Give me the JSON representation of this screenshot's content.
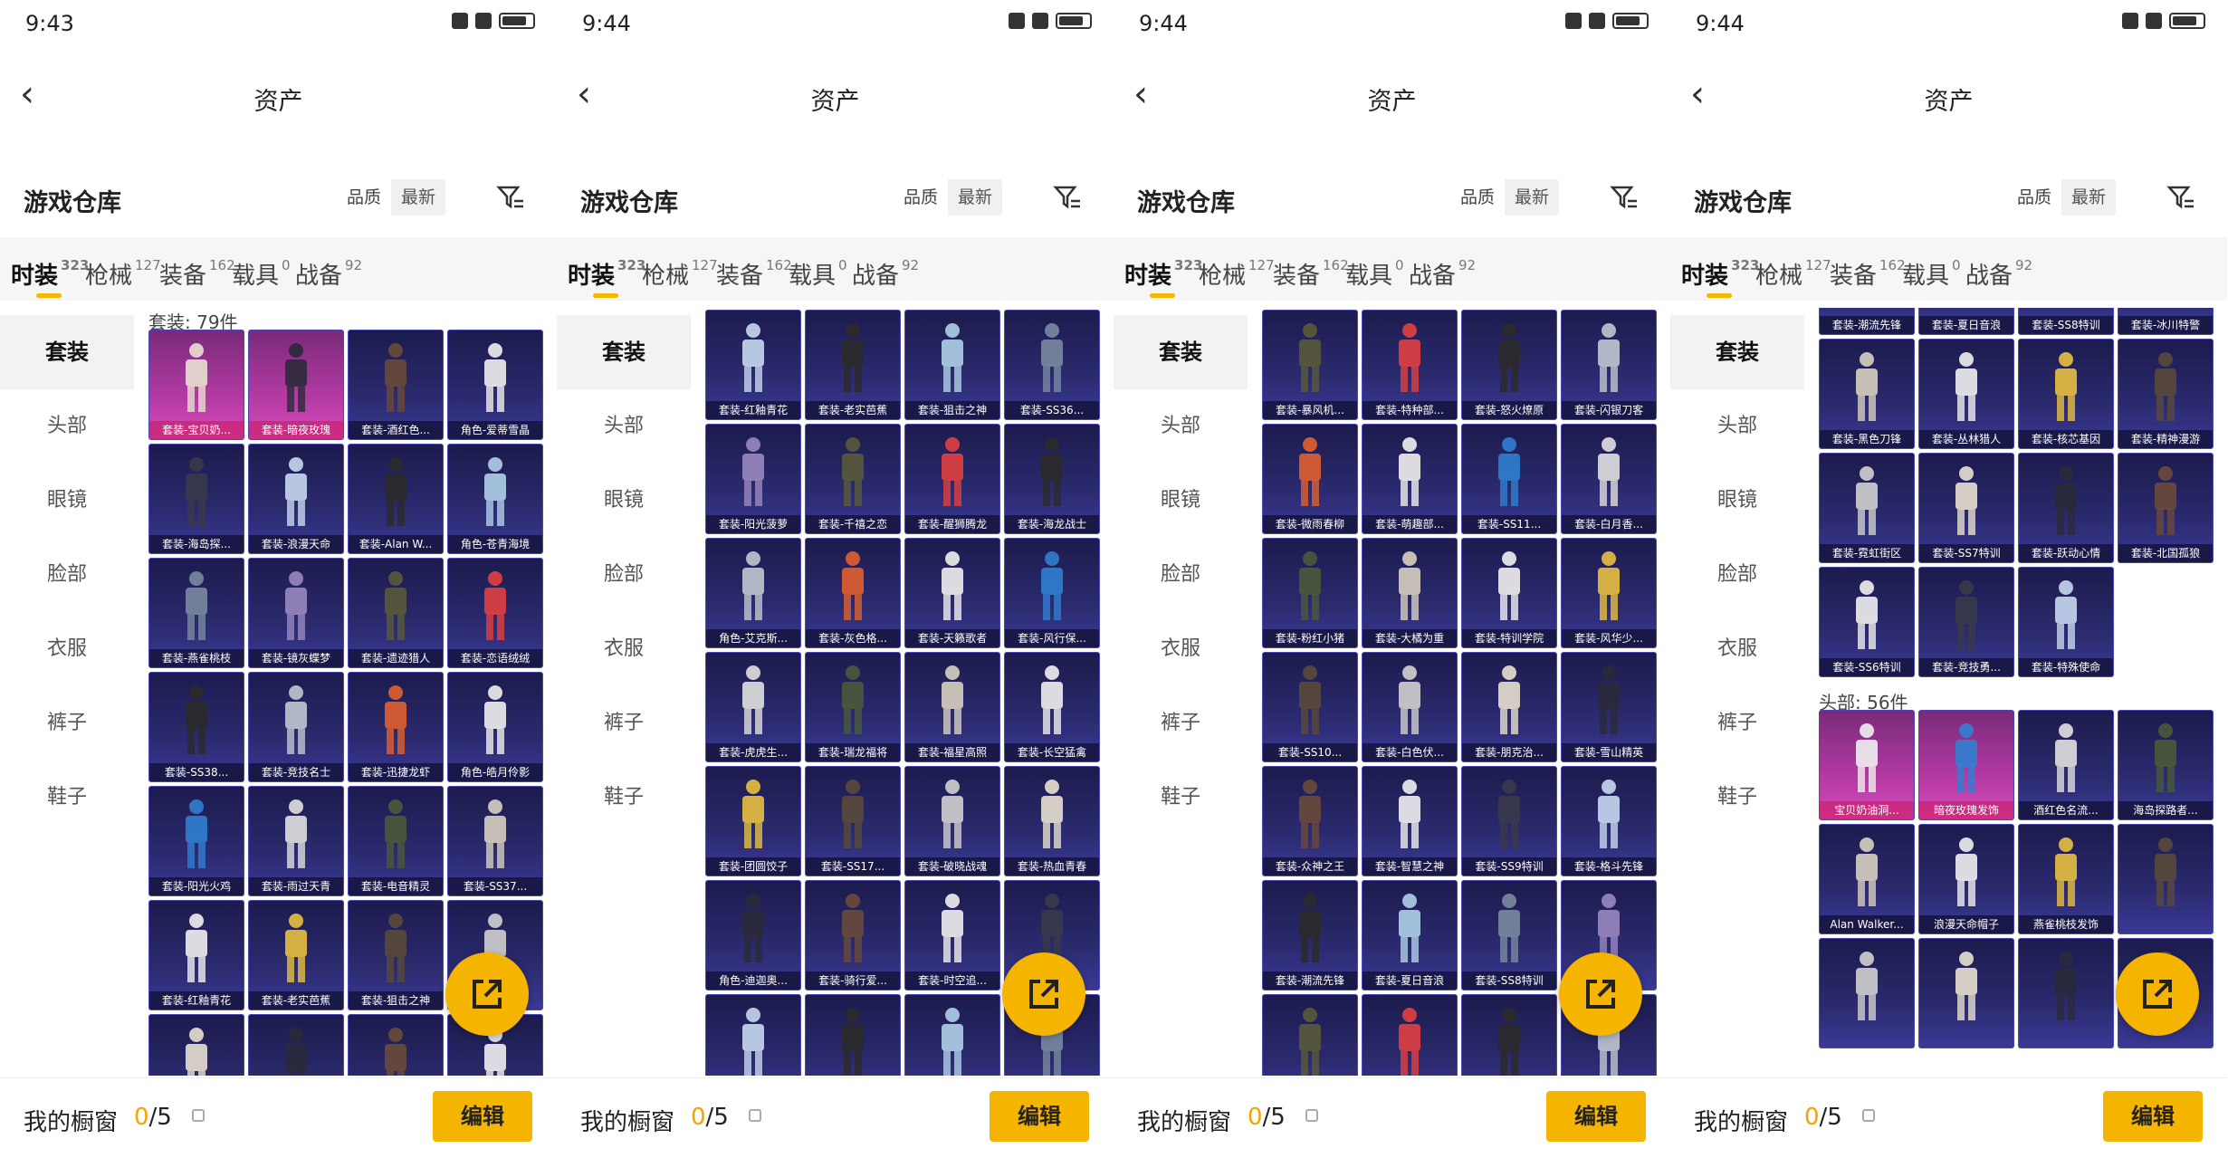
{
  "panels": [
    {
      "time": "9:43",
      "title": "资产",
      "warehouse": "游戏仓库",
      "sort": [
        "品质",
        "最新"
      ],
      "tabs": [
        {
          "label": "时装",
          "count": "323"
        },
        {
          "label": "枪械",
          "count": "127"
        },
        {
          "label": "装备",
          "count": "162"
        },
        {
          "label": "载具",
          "count": "0"
        },
        {
          "label": "战备",
          "count": "92"
        }
      ],
      "side": [
        "套装",
        "头部",
        "眼镜",
        "脸部",
        "衣服",
        "裤子",
        "鞋子"
      ],
      "sections": [
        {
          "header": "套装: 79件",
          "items": [
            "套装-宝贝奶...",
            "套装-暗夜玫瑰",
            "套装-酒红色...",
            "角色-爱蒂雪晶",
            "套装-海岛探...",
            "套装-浪漫天命",
            "套装-Alan W...",
            "角色-苍青海境",
            "套装-燕雀桃枝",
            "套装-镜灰蝶梦",
            "套装-遗迹猎人",
            "套装-恋语绒绒",
            "套装-SS38...",
            "套装-竞技名士",
            "套装-迅捷龙虾",
            "角色-皓月伶影",
            "套装-阳光火鸡",
            "套装-雨过天青",
            "套装-电音精灵",
            "套装-SS37...",
            "套装-红釉青花",
            "套装-老实芭蕉",
            "套装-狙击之神",
            "",
            "",
            "",
            "",
            ""
          ]
        }
      ],
      "bottom": {
        "label": "我的橱窗",
        "count": "0",
        "total": "/5",
        "edit": "编辑"
      }
    },
    {
      "time": "9:44",
      "title": "资产",
      "warehouse": "游戏仓库",
      "sort": [
        "品质",
        "最新"
      ],
      "tabs": [
        {
          "label": "时装",
          "count": "323"
        },
        {
          "label": "枪械",
          "count": "127"
        },
        {
          "label": "装备",
          "count": "162"
        },
        {
          "label": "载具",
          "count": "0"
        },
        {
          "label": "战备",
          "count": "92"
        }
      ],
      "side": [
        "套装",
        "头部",
        "眼镜",
        "脸部",
        "衣服",
        "裤子",
        "鞋子"
      ],
      "sections": [
        {
          "header": "",
          "items": [
            "套装-红釉青花",
            "套装-老实芭蕉",
            "套装-狙击之神",
            "套装-SS36...",
            "套装-阳光菠萝",
            "套装-千禧之恋",
            "套装-醒狮腾龙",
            "套装-海龙战士",
            "角色-艾克斯...",
            "套装-灰色格...",
            "套装-天籁歌者",
            "套装-风行保...",
            "套装-虎虎生...",
            "套装-瑞龙福将",
            "套装-福星高照",
            "套装-长空猛禽",
            "套装-团圆饺子",
            "套装-SS17...",
            "套装-破晓战魂",
            "套装-热血青春",
            "角色-迪迦奥...",
            "套装-骑行爱...",
            "套装-时空追...",
            "",
            "",
            "",
            "",
            ""
          ]
        }
      ],
      "bottom": {
        "label": "我的橱窗",
        "count": "0",
        "total": "/5",
        "edit": "编辑"
      }
    },
    {
      "time": "9:44",
      "title": "资产",
      "warehouse": "游戏仓库",
      "sort": [
        "品质",
        "最新"
      ],
      "tabs": [
        {
          "label": "时装",
          "count": "323"
        },
        {
          "label": "枪械",
          "count": "127"
        },
        {
          "label": "装备",
          "count": "162"
        },
        {
          "label": "载具",
          "count": "0"
        },
        {
          "label": "战备",
          "count": "92"
        }
      ],
      "side": [
        "套装",
        "头部",
        "眼镜",
        "脸部",
        "衣服",
        "裤子",
        "鞋子"
      ],
      "sections": [
        {
          "header": "",
          "items": [
            "套装-暴风机...",
            "套装-特种部...",
            "套装-怒火燎原",
            "套装-闪银刀客",
            "套装-微雨春柳",
            "套装-萌趣部...",
            "套装-SS11...",
            "套装-白月香...",
            "套装-粉红小猪",
            "套装-大橘为重",
            "套装-特训学院",
            "套装-风华少...",
            "套装-SS10...",
            "套装-白色伏...",
            "套装-朋克治...",
            "套装-雪山精英",
            "套装-众神之王",
            "套装-智慧之神",
            "套装-SS9特训",
            "套装-格斗先锋",
            "套装-潮流先锋",
            "套装-夏日音浪",
            "套装-SS8特训",
            "",
            "",
            "",
            "",
            ""
          ]
        }
      ],
      "bottom": {
        "label": "我的橱窗",
        "count": "0",
        "total": "/5",
        "edit": "编辑"
      }
    },
    {
      "time": "9:44",
      "title": "资产",
      "warehouse": "游戏仓库",
      "sort": [
        "品质",
        "最新"
      ],
      "tabs": [
        {
          "label": "时装",
          "count": "323"
        },
        {
          "label": "枪械",
          "count": "127"
        },
        {
          "label": "装备",
          "count": "162"
        },
        {
          "label": "载具",
          "count": "0"
        },
        {
          "label": "战备",
          "count": "92"
        }
      ],
      "side": [
        "套装",
        "头部",
        "眼镜",
        "脸部",
        "衣服",
        "裤子",
        "鞋子"
      ],
      "sections": [
        {
          "header": "",
          "items": [
            "套装-潮流先锋",
            "套装-夏日音浪",
            "套装-SS8特训",
            "套装-冰川特警",
            "套装-黑色刀锋",
            "套装-丛林猎人",
            "套装-核芯基因",
            "套装-精神漫游",
            "套装-霓虹街区",
            "套装-SS7特训",
            "套装-跃动心情",
            "套装-北国孤狼",
            "套装-SS6特训",
            "套装-竞技勇...",
            "套装-特殊使命"
          ]
        },
        {
          "header": "头部: 56件",
          "items": [
            "宝贝奶油洞...",
            "暗夜玫瑰发饰",
            "酒红色名流...",
            "海岛探路者...",
            "Alan Walker...",
            "浪漫天命帽子",
            "燕雀桃枝发饰",
            "",
            "",
            "",
            "",
            ""
          ]
        }
      ],
      "bottom": {
        "label": "我的橱窗",
        "count": "0",
        "total": "/5",
        "edit": "编辑"
      }
    }
  ]
}
